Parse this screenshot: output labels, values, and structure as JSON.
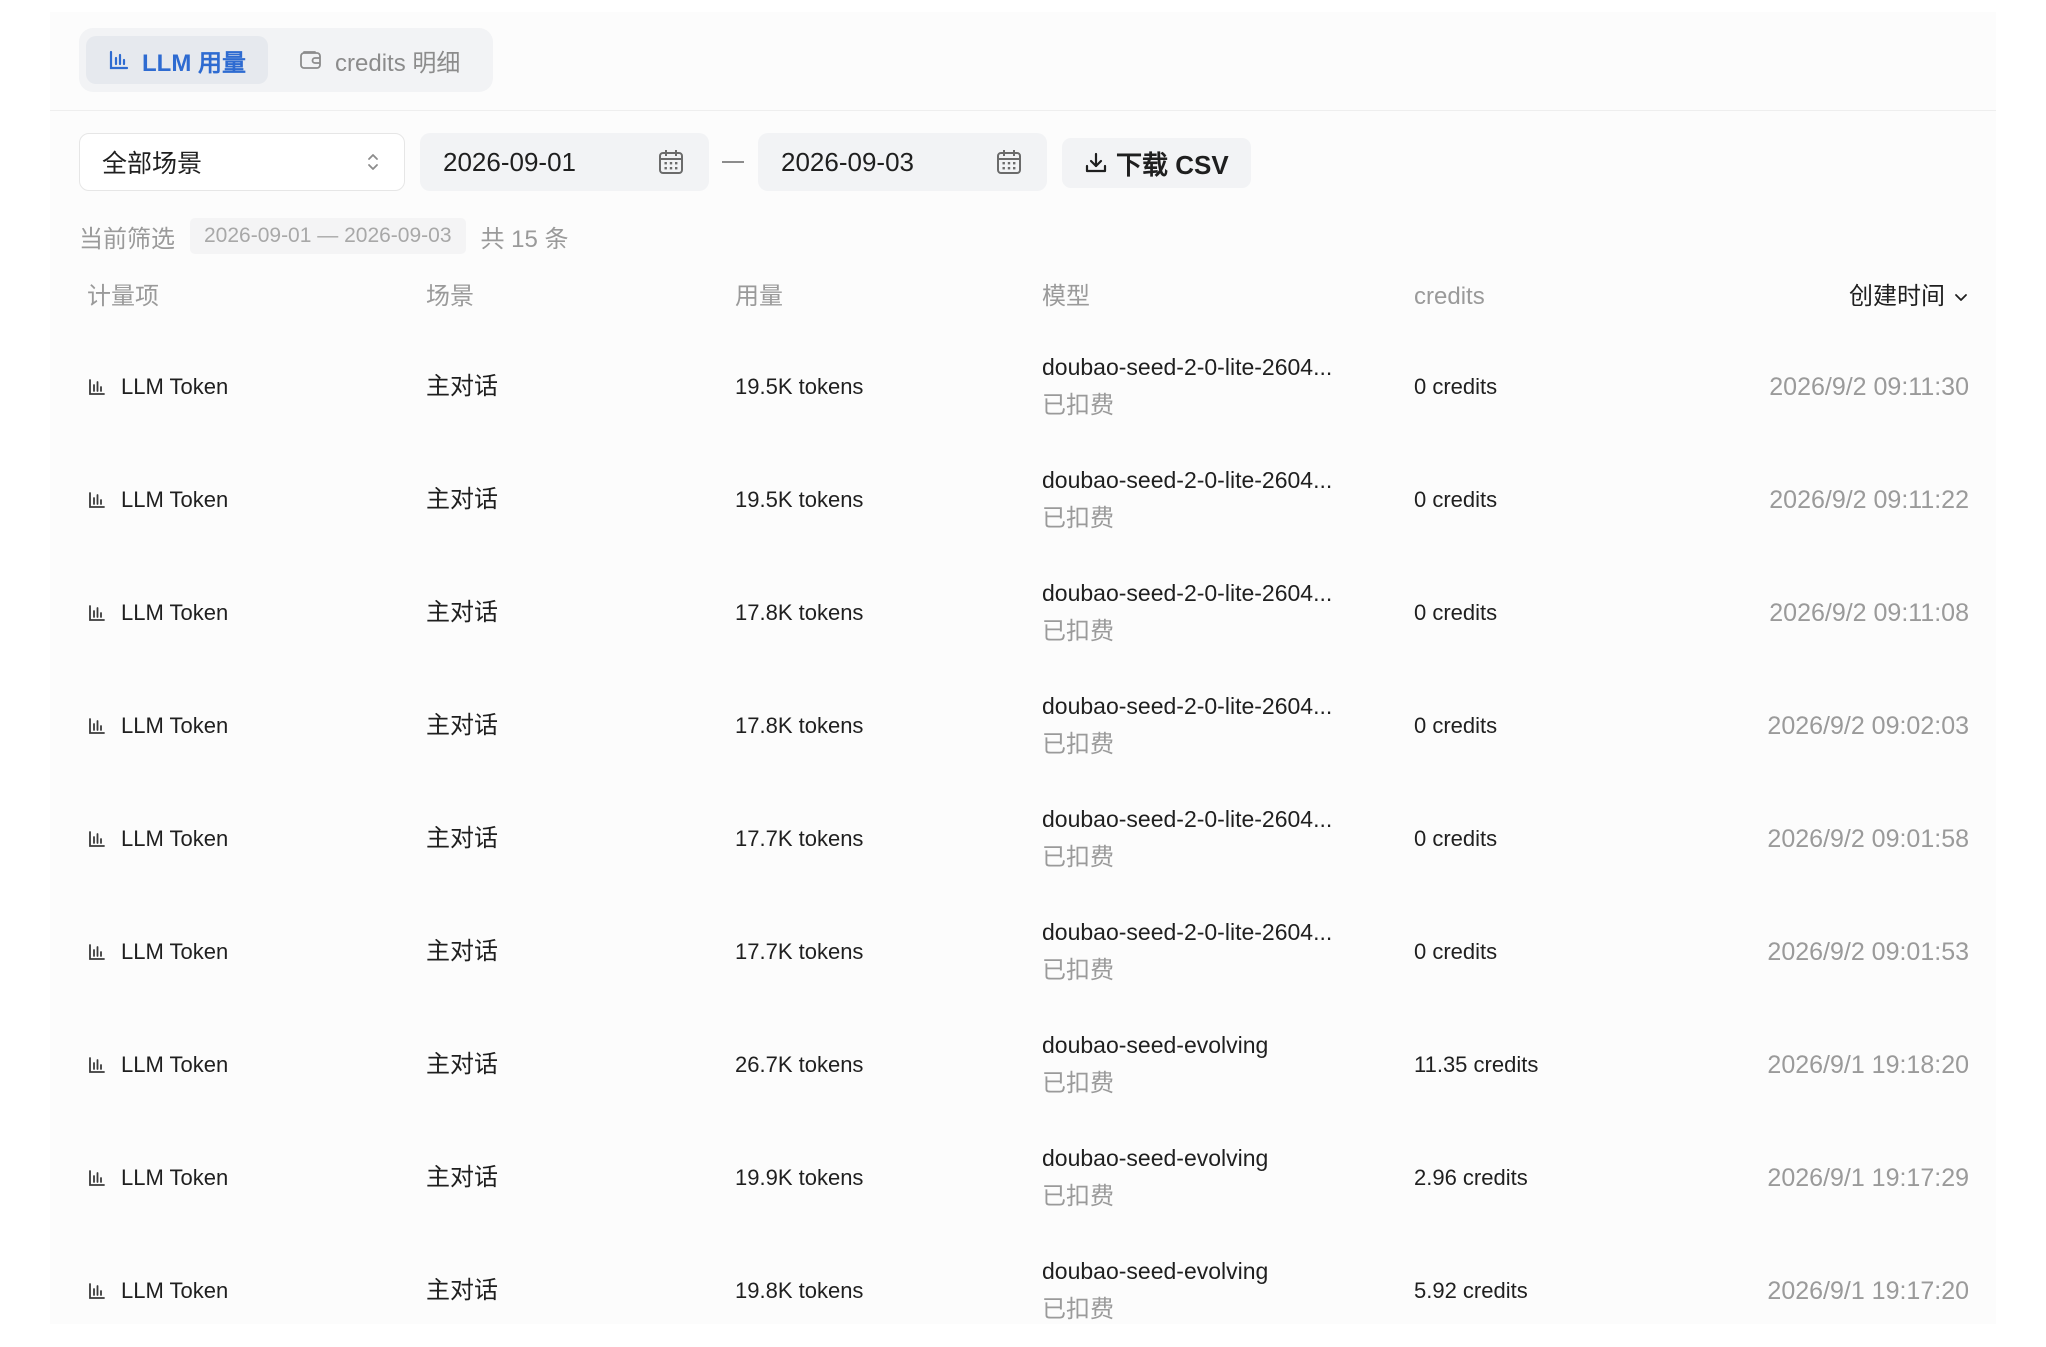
{
  "tabs": [
    {
      "label": "LLM 用量",
      "active": true,
      "icon": "bar-chart-icon"
    },
    {
      "label": "credits 明细",
      "active": false,
      "icon": "wallet-icon"
    }
  ],
  "filters": {
    "scene_select": "全部场景",
    "start_date": "2026-09-01",
    "end_date": "2026-09-03",
    "download_label": "下载 CSV"
  },
  "summary": {
    "label": "当前筛选",
    "range": "2026-09-01 — 2026-09-03",
    "count": "共 15 条"
  },
  "table": {
    "headers": {
      "item": "计量项",
      "scene": "场景",
      "usage": "用量",
      "model": "模型",
      "credits": "credits",
      "time": "创建时间"
    },
    "rows": [
      {
        "item": "LLM Token",
        "scene": "主对话",
        "usage": "19.5K tokens",
        "model": "doubao-seed-2-0-lite-2604...",
        "status": "已扣费",
        "credits": "0 credits",
        "time": "2026/9/2 09:11:30"
      },
      {
        "item": "LLM Token",
        "scene": "主对话",
        "usage": "19.5K tokens",
        "model": "doubao-seed-2-0-lite-2604...",
        "status": "已扣费",
        "credits": "0 credits",
        "time": "2026/9/2 09:11:22"
      },
      {
        "item": "LLM Token",
        "scene": "主对话",
        "usage": "17.8K tokens",
        "model": "doubao-seed-2-0-lite-2604...",
        "status": "已扣费",
        "credits": "0 credits",
        "time": "2026/9/2 09:11:08"
      },
      {
        "item": "LLM Token",
        "scene": "主对话",
        "usage": "17.8K tokens",
        "model": "doubao-seed-2-0-lite-2604...",
        "status": "已扣费",
        "credits": "0 credits",
        "time": "2026/9/2 09:02:03"
      },
      {
        "item": "LLM Token",
        "scene": "主对话",
        "usage": "17.7K tokens",
        "model": "doubao-seed-2-0-lite-2604...",
        "status": "已扣费",
        "credits": "0 credits",
        "time": "2026/9/2 09:01:58"
      },
      {
        "item": "LLM Token",
        "scene": "主对话",
        "usage": "17.7K tokens",
        "model": "doubao-seed-2-0-lite-2604...",
        "status": "已扣费",
        "credits": "0 credits",
        "time": "2026/9/2 09:01:53"
      },
      {
        "item": "LLM Token",
        "scene": "主对话",
        "usage": "26.7K tokens",
        "model": "doubao-seed-evolving",
        "status": "已扣费",
        "credits": "11.35 credits",
        "time": "2026/9/1 19:18:20"
      },
      {
        "item": "LLM Token",
        "scene": "主对话",
        "usage": "19.9K tokens",
        "model": "doubao-seed-evolving",
        "status": "已扣费",
        "credits": "2.96 credits",
        "time": "2026/9/1 19:17:29"
      },
      {
        "item": "LLM Token",
        "scene": "主对话",
        "usage": "19.8K tokens",
        "model": "doubao-seed-evolving",
        "status": "已扣费",
        "credits": "5.92 credits",
        "time": "2026/9/1 19:17:20"
      }
    ]
  },
  "colors": {
    "accent": "#2e6bd1",
    "muted": "#9a9a9a",
    "control_bg": "#f2f3f5"
  }
}
